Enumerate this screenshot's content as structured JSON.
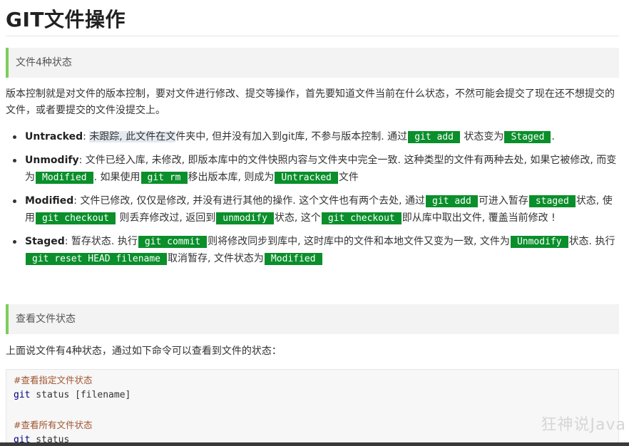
{
  "title": "GIT文件操作",
  "section1": {
    "heading": "文件4种状态",
    "intro": "版本控制就是对文件的版本控制，要对文件进行修改、提交等操作，首先要知道文件当前在什么状态，不然可能会提交了现在还不想提交的文件，或者要提交的文件没提交上。",
    "items": [
      {
        "term": "Untracked",
        "parts": [
          {
            "t": ": "
          },
          {
            "t": "未跟踪, 此文件在文",
            "hl": true
          },
          {
            "t": "件夹中, 但并没有加入到git库, 不参与版本控制. 通过"
          },
          {
            "c": "git add"
          },
          {
            "t": " 状态变为"
          },
          {
            "c": "Staged"
          },
          {
            "t": "."
          }
        ]
      },
      {
        "term": "Unmodify",
        "parts": [
          {
            "t": ": 文件已经入库, 未修改, 即版本库中的文件快照内容与文件夹中完全一致. 这种类型的文件有两种去处, 如果它被修改, 而变为"
          },
          {
            "c": "Modified"
          },
          {
            "t": ". 如果使用"
          },
          {
            "c": "git rm"
          },
          {
            "t": "移出版本库, 则成为"
          },
          {
            "c": "Untracked"
          },
          {
            "t": "文件"
          }
        ]
      },
      {
        "term": "Modified",
        "parts": [
          {
            "t": ": 文件已修改, 仅仅是修改, 并没有进行其他的操作. 这个文件也有两个去处, 通过"
          },
          {
            "c": "git add"
          },
          {
            "t": "可进入暂存"
          },
          {
            "c": "staged"
          },
          {
            "t": "状态, 使用"
          },
          {
            "c": "git checkout"
          },
          {
            "t": " 则丢弃修改过, 返回到"
          },
          {
            "c": "unmodify"
          },
          {
            "t": "状态, 这个"
          },
          {
            "c": "git checkout"
          },
          {
            "t": "即从库中取出文件, 覆盖当前修改 !"
          }
        ]
      },
      {
        "term": "Staged",
        "parts": [
          {
            "t": ": 暂存状态. 执行"
          },
          {
            "c": "git commit"
          },
          {
            "t": "则将修改同步到库中, 这时库中的文件和本地文件又变为一致, 文件为"
          },
          {
            "c": "Unmodify"
          },
          {
            "t": "状态. 执行"
          },
          {
            "c": "git reset HEAD filename"
          },
          {
            "t": "取消暂存, 文件状态为"
          },
          {
            "c": "Modified"
          }
        ]
      }
    ]
  },
  "section2": {
    "heading": "查看文件状态",
    "intro": "上面说文件有4种状态，通过如下命令可以查看到文件的状态：",
    "code": {
      "comment1": "#查看指定文件状态",
      "cmd1_kw": "git",
      "cmd1_rest": " status [filename]",
      "comment2": "#查看所有文件状态",
      "cmd2_kw": "git",
      "cmd2_rest": " status"
    }
  },
  "watermark": "狂神说Java"
}
